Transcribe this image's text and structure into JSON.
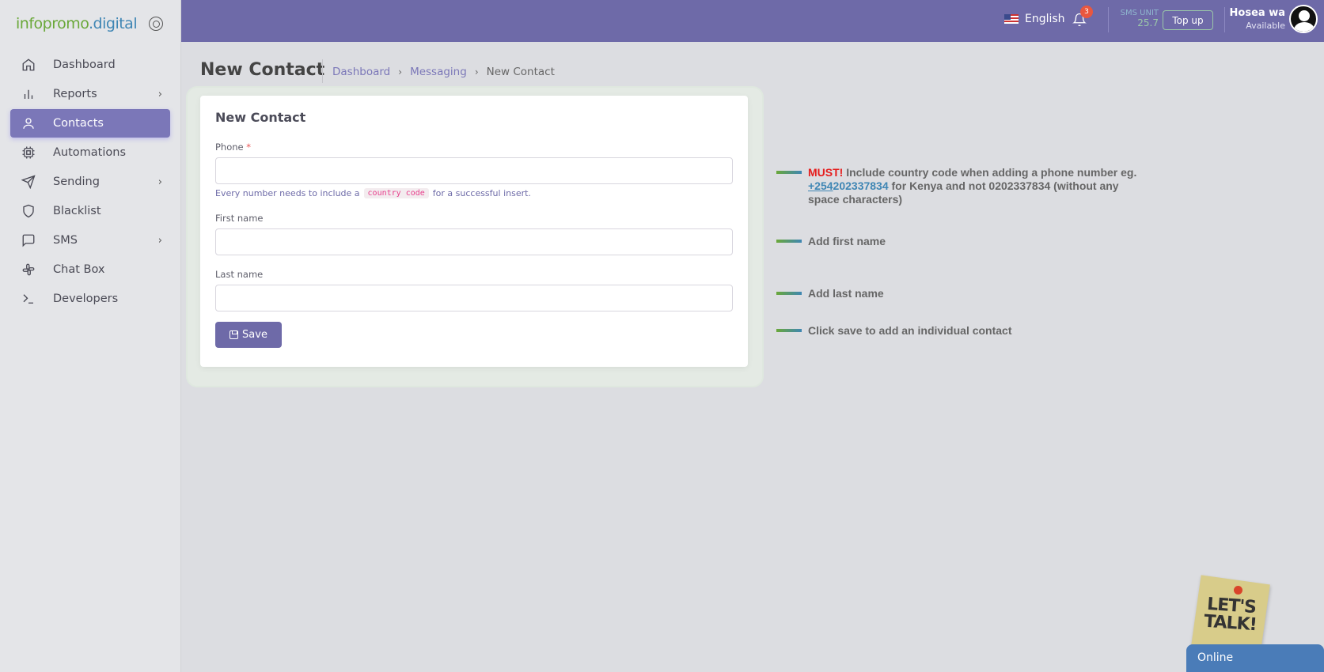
{
  "brand": {
    "logo_part1": "infopromo",
    "logo_part2": ".digital"
  },
  "sidebar": {
    "items": [
      {
        "label": "Dashboard",
        "icon": "home-icon",
        "active": false,
        "has_children": false
      },
      {
        "label": "Reports",
        "icon": "bar-chart-icon",
        "active": false,
        "has_children": true
      },
      {
        "label": "Contacts",
        "icon": "user-icon",
        "active": true,
        "has_children": false
      },
      {
        "label": "Automations",
        "icon": "cpu-icon",
        "active": false,
        "has_children": false
      },
      {
        "label": "Sending",
        "icon": "send-icon",
        "active": false,
        "has_children": true
      },
      {
        "label": "Blacklist",
        "icon": "shield-icon",
        "active": false,
        "has_children": false
      },
      {
        "label": "SMS",
        "icon": "message-square-icon",
        "active": false,
        "has_children": true
      },
      {
        "label": "Chat Box",
        "icon": "slack-icon",
        "active": false,
        "has_children": false
      },
      {
        "label": "Developers",
        "icon": "terminal-icon",
        "active": false,
        "has_children": false
      }
    ]
  },
  "topbar": {
    "language": "English",
    "notification_count": "3",
    "sms_unit_label": "SMS UNIT",
    "sms_unit_value": "25.7",
    "topup_label": "Top up",
    "user_name": "Hosea wa",
    "user_status": "Available"
  },
  "page": {
    "title": "New Contact",
    "breadcrumb": [
      "Dashboard",
      "Messaging",
      "New Contact"
    ]
  },
  "form": {
    "title": "New Contact",
    "phone_label": "Phone",
    "phone_required_mark": "*",
    "phone_value": "",
    "phone_hint_before": "Every number needs to include a",
    "phone_hint_code": "country code",
    "phone_hint_after": "for a successful insert.",
    "first_name_label": "First name",
    "first_name_value": "",
    "last_name_label": "Last name",
    "last_name_value": "",
    "save_label": "Save"
  },
  "tips": {
    "phone_must": "MUST!",
    "phone_text1": "Include country code when adding a phone number eg.",
    "phone_example_code": "+254",
    "phone_example_number": "202337834",
    "phone_text2": "for Kenya and not 0202337834 (without any space characters)",
    "first_name": "Add first name",
    "last_name": "Add last name",
    "save": "Click save to add an individual contact"
  },
  "chat_widget": {
    "sticker_line1": "LET'S",
    "sticker_line2": "TALK!",
    "status": "Online"
  },
  "colors": {
    "primary": "#6e6aa8",
    "active_nav": "#7b77b8",
    "brand_green": "#6aa839",
    "brand_blue": "#3f86b4",
    "danger": "#e51c1c"
  }
}
